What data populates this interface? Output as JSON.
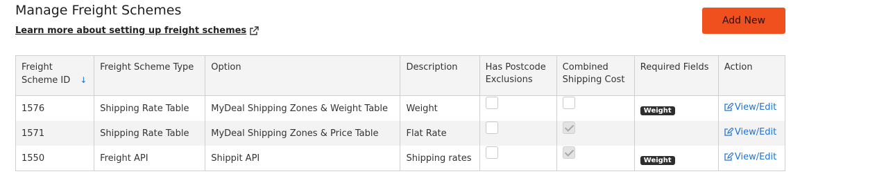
{
  "header": {
    "title": "Manage Freight Schemes",
    "learn_link": "Learn more about setting up freight schemes",
    "add_button": "Add New"
  },
  "table": {
    "columns": [
      {
        "label": "Freight Scheme ID",
        "sortable": true
      },
      {
        "label": "Freight Scheme Type"
      },
      {
        "label": "Option"
      },
      {
        "label": "Description"
      },
      {
        "label": "Has Postcode Exclusions"
      },
      {
        "label": "Combined Shipping Cost"
      },
      {
        "label": "Required Fields"
      },
      {
        "label": "Action"
      }
    ],
    "rows": [
      {
        "id": "1576",
        "type": "Shipping Rate Table",
        "option": "MyDeal Shipping Zones & Weight Table",
        "description": "Weight",
        "postcode_exclusions": false,
        "combined_shipping": false,
        "required_fields": "Weight",
        "action": "View/Edit"
      },
      {
        "id": "1571",
        "type": "Shipping Rate Table",
        "option": "MyDeal Shipping Zones & Price Table",
        "description": "Flat Rate",
        "postcode_exclusions": false,
        "combined_shipping": true,
        "required_fields": "",
        "action": "View/Edit"
      },
      {
        "id": "1550",
        "type": "Freight API",
        "option": "Shippit API",
        "description": "Shipping rates",
        "postcode_exclusions": false,
        "combined_shipping": true,
        "required_fields": "Weight",
        "action": "View/Edit"
      }
    ]
  },
  "colors": {
    "accent": "#f0501e",
    "link": "#1e73d6",
    "badge": "#2e2e2e"
  }
}
